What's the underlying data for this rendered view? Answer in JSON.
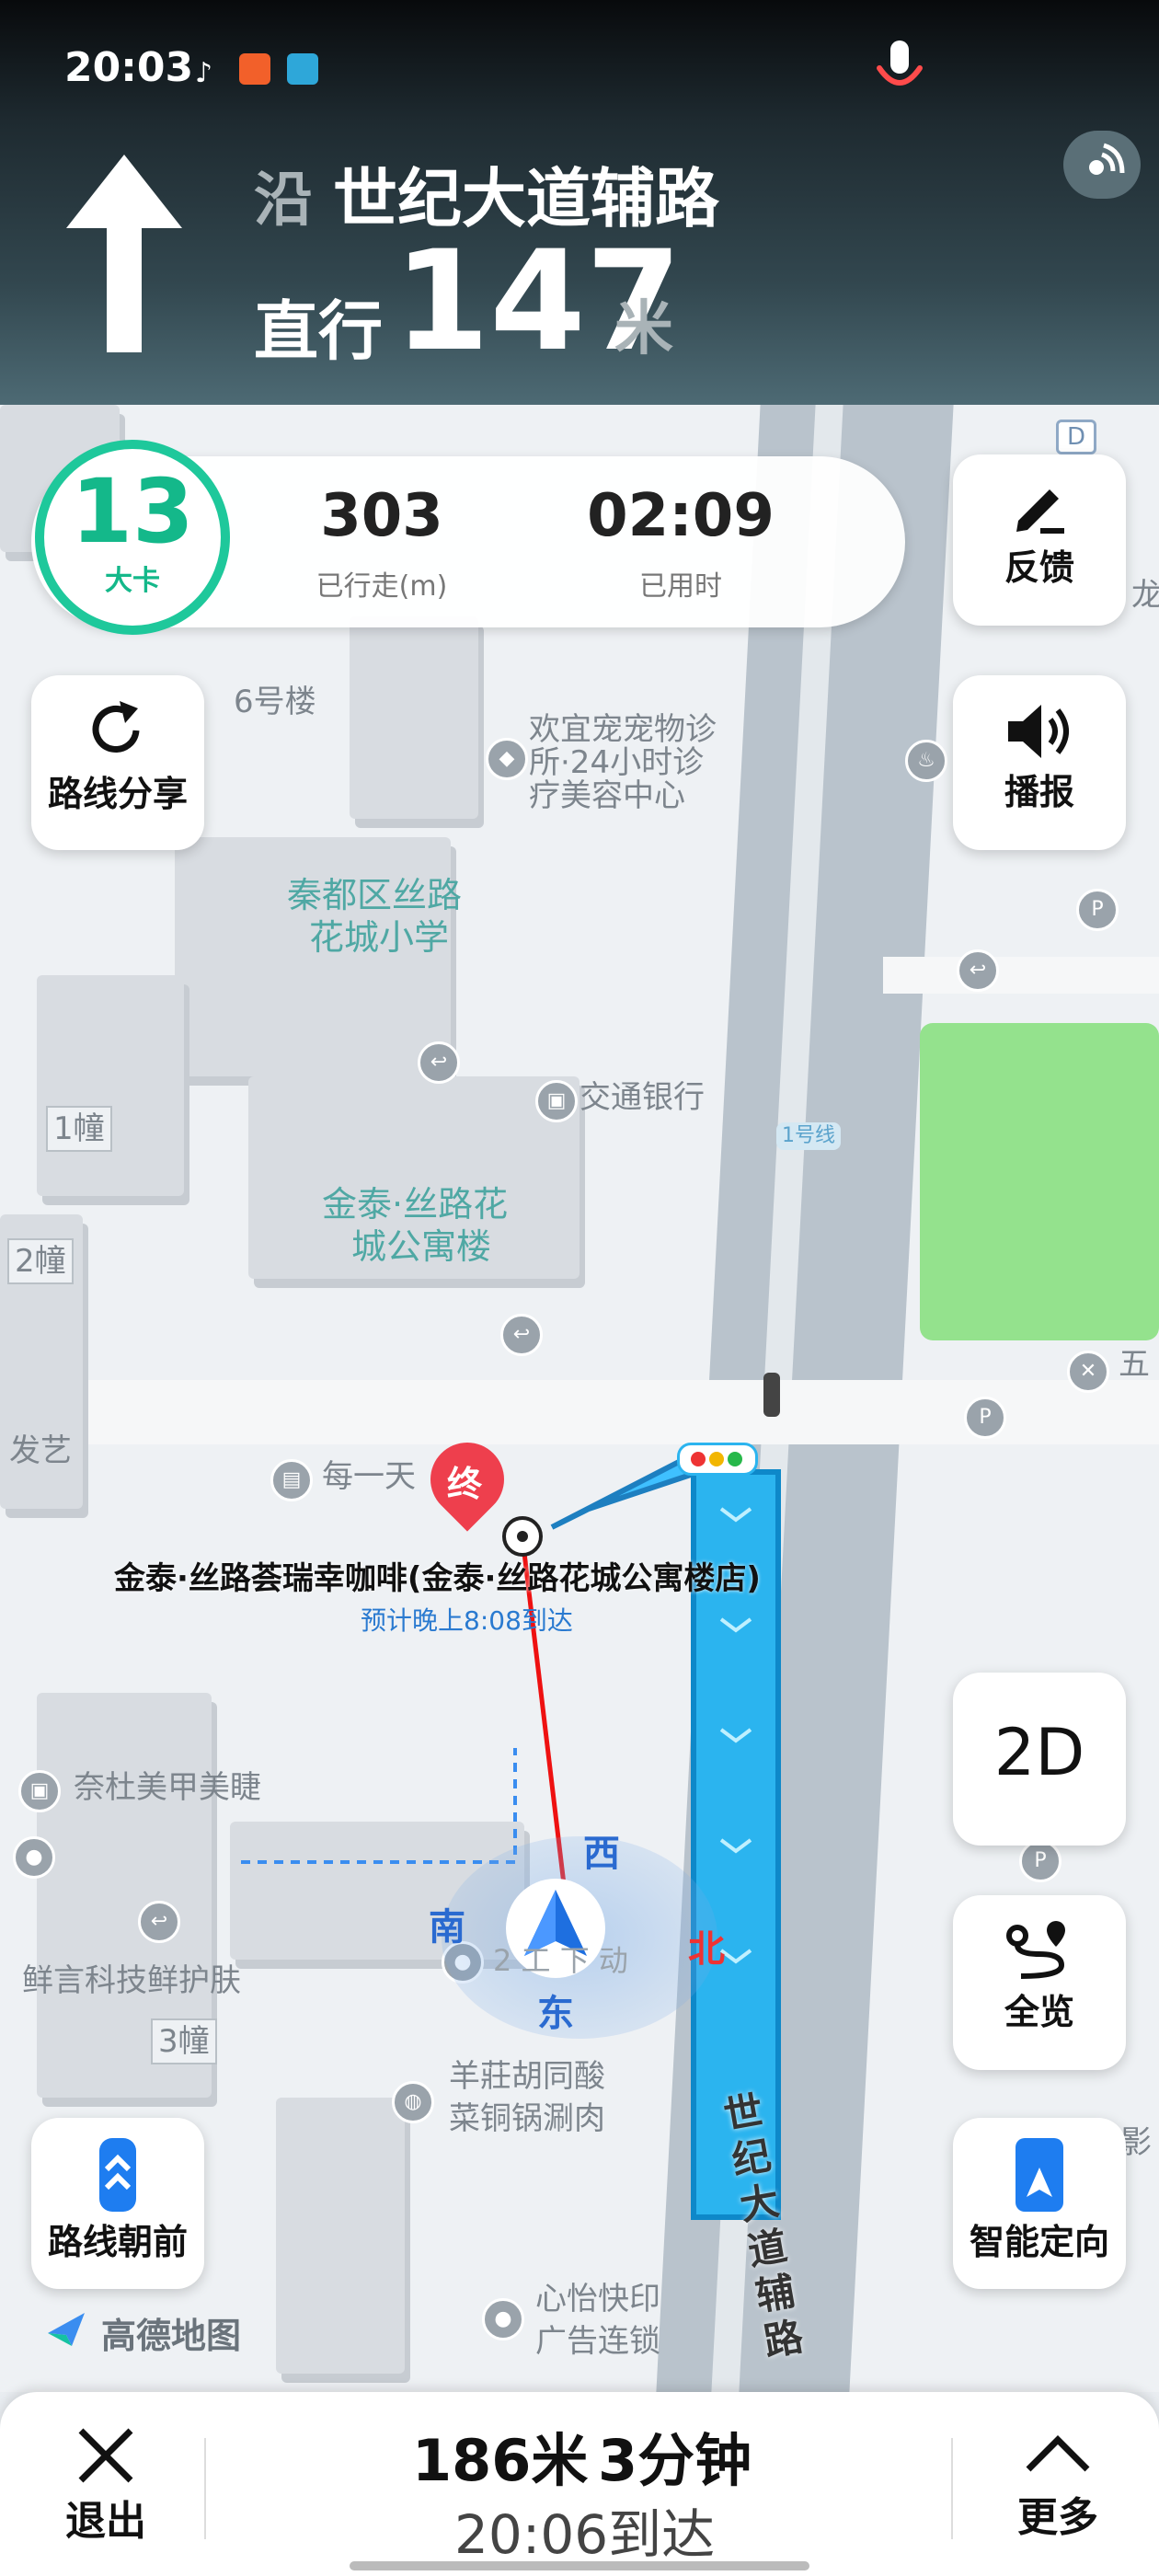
{
  "status_bar": {
    "time": "20:03"
  },
  "nav": {
    "prefix": "沿",
    "road": "世纪大道辅路",
    "action": "直行",
    "distance": "147",
    "unit": "米"
  },
  "stats": {
    "speed_limit": "13",
    "speed_label": "大卡",
    "traveled_value": "303",
    "traveled_label": "已行走(m)",
    "elapsed_value": "02:09",
    "elapsed_label": "已用时"
  },
  "buttons": {
    "feedback": "反馈",
    "share": "路线分享",
    "broadcast": "播报",
    "view_2d": "2D",
    "overview": "全览",
    "heading_up": "路线朝前",
    "smart_orient": "智能定向",
    "exit": "退出",
    "more": "更多"
  },
  "map": {
    "labels": {
      "building6": "6号楼",
      "pet1": "欢宜宠宠物诊",
      "pet2": "所·24小时诊",
      "pet3": "疗美容中心",
      "school1": "秦都区丝路",
      "school2": "花城小学",
      "bank": "交通银行",
      "line1": "1号线",
      "bld1": "1幢",
      "bld2": "2幢",
      "apt1": "金泰·丝路花",
      "apt2": "城公寓楼",
      "five": "五",
      "art": "发艺",
      "daily": "每一天",
      "end_marker": "终",
      "dest_name": "金泰·丝路荟瑞幸咖啡(金泰·丝路花城公寓楼店)",
      "eta_note": "预计晚上8:08到达",
      "beauty": "奈杜美甲美睫",
      "skin": "鲜言科技鲜护肤",
      "bld3": "3幢",
      "hotpot1": "羊莊胡同酸",
      "hotpot2": "菜铜锅涮肉",
      "ad1": "心怡快印",
      "ad2": "广告连锁",
      "road_vertical": "世纪大道辅路",
      "dragon": "龙",
      "shadow": "影",
      "dir_west": "西",
      "dir_south": "南",
      "dir_north": "北",
      "dir_east": "东",
      "ghost": "2 工 下 动",
      "logo": "高德地图",
      "d_marker": "D"
    }
  },
  "bottom": {
    "distance": "186米",
    "duration": "3分钟",
    "arrival": "20:06到达"
  },
  "colors": {
    "accent": "#1ec89b",
    "route": "#1aa7f0",
    "park": "#94e28d",
    "header": "#32474f"
  }
}
